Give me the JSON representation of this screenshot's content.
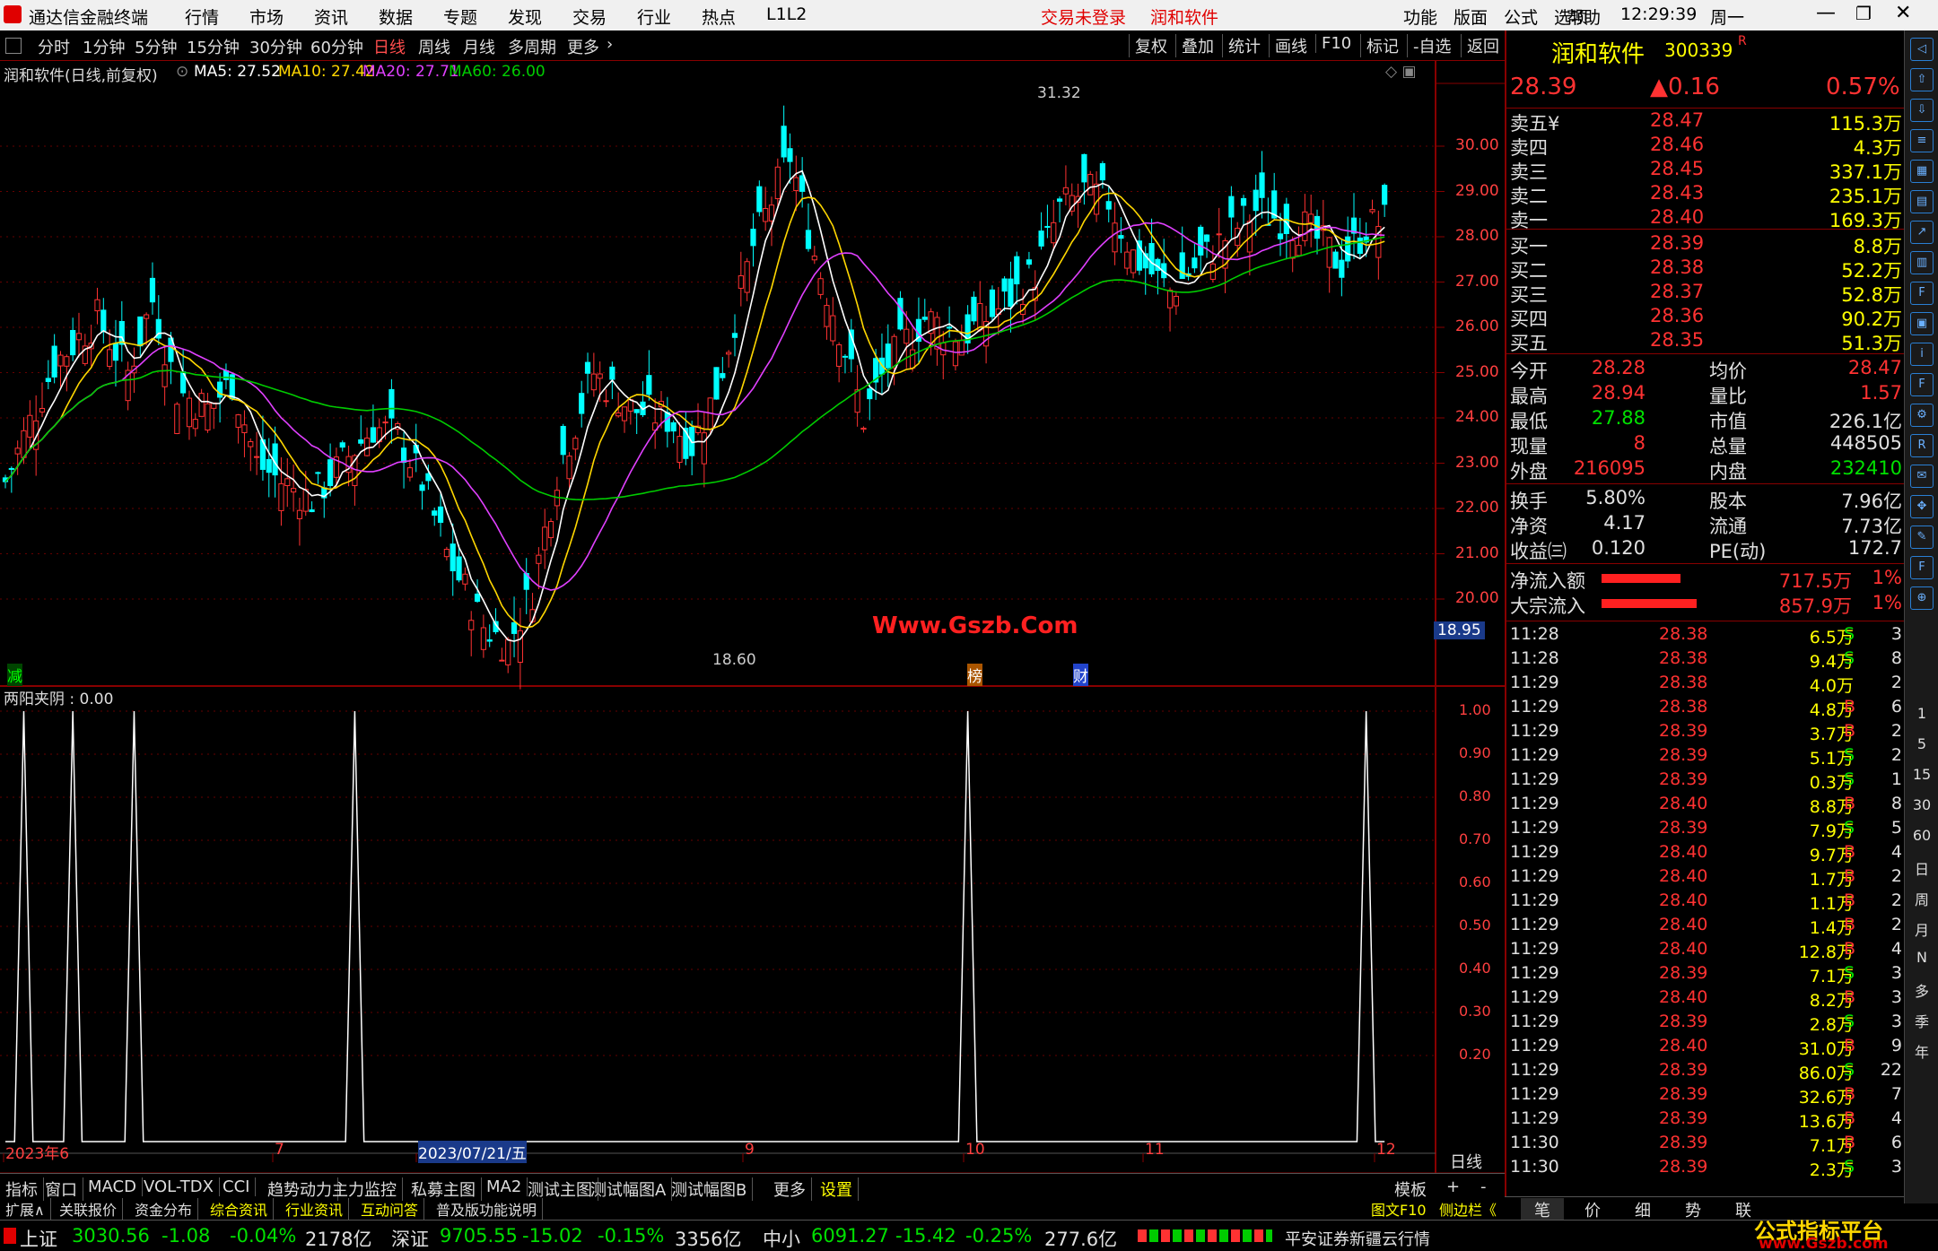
{
  "menu": {
    "app_title": "通达信金融终端",
    "items": [
      "行情",
      "市场",
      "资讯",
      "数据",
      "专题",
      "发现",
      "交易",
      "行业",
      "热点",
      "L1L2"
    ],
    "login": "交易未登录",
    "stock_name_top": "润和软件",
    "right_items": [
      "功能",
      "版面",
      "公式",
      "选项",
      "帮助"
    ],
    "clock": "12:29:39",
    "weekday": "周一"
  },
  "periods": [
    "分时",
    "1分钟",
    "5分钟",
    "15分钟",
    "30分钟",
    "60分钟",
    "日线",
    "周线",
    "月线",
    "多周期",
    "更多"
  ],
  "toolbar_right": [
    "复权",
    "叠加",
    "统计",
    "画线",
    "F10",
    "标记",
    "-自选",
    "返回"
  ],
  "legend": {
    "name": "润和软件(日线,前复权)",
    "ma5": "MA5: 27.52",
    "ma10": "MA10: 27.42",
    "ma20": "MA20: 27.71",
    "ma60": "MA60: 26.00"
  },
  "chart_labels": {
    "high": "31.32",
    "low": "18.60",
    "watermark": "Www.Gszb.Com",
    "cursor_price": "18.95",
    "mark_jian": "减",
    "mark_bang": "榜",
    "mark_cai": "财"
  },
  "indicator": {
    "title": "两阳夹阴 : 0.00"
  },
  "x_axis": {
    "labels": [
      "2023年6",
      "7",
      "2023/07/21/五",
      "9",
      "10",
      "11",
      "12"
    ],
    "right_label": "日线"
  },
  "chart_data": [
    {
      "type": "candlestick",
      "ylim": [
        18.6,
        31.32
      ],
      "price_axis": [
        "30.00",
        "29.00",
        "28.00",
        "27.00",
        "26.00",
        "25.00",
        "24.00",
        "23.00",
        "22.00",
        "21.00",
        "20.00"
      ],
      "high": 31.32,
      "low": 18.6,
      "series": [
        {
          "name": "MA5",
          "value": "27.52"
        },
        {
          "name": "MA10",
          "value": "27.42"
        },
        {
          "name": "MA20",
          "value": "27.71"
        },
        {
          "name": "MA60",
          "value": "26.00"
        }
      ]
    },
    {
      "type": "line",
      "name": "两阳夹阴",
      "ylim": [
        0,
        1
      ],
      "y_axis": [
        "1.00",
        "0.90",
        "0.80",
        "0.70",
        "0.60",
        "0.50",
        "0.40",
        "0.30",
        "0.20"
      ],
      "spikes": [
        3,
        11,
        21,
        57,
        157,
        222
      ]
    }
  ],
  "quote": {
    "name": "润和软件",
    "code": "300339",
    "badge": "R",
    "price": "28.39",
    "change": "▲0.16",
    "pct": "0.57%",
    "asks": [
      [
        "卖五¥",
        "28.47",
        "115.3万"
      ],
      [
        "卖四",
        "28.46",
        "4.3万"
      ],
      [
        "卖三",
        "28.45",
        "337.1万"
      ],
      [
        "卖二",
        "28.43",
        "235.1万"
      ],
      [
        "卖一",
        "28.40",
        "169.3万"
      ]
    ],
    "bids": [
      [
        "买一",
        "28.39",
        "8.8万"
      ],
      [
        "买二",
        "28.38",
        "52.2万"
      ],
      [
        "买三",
        "28.37",
        "52.8万"
      ],
      [
        "买四",
        "28.36",
        "90.2万"
      ],
      [
        "买五",
        "28.35",
        "51.3万"
      ]
    ],
    "stats": [
      [
        "今开",
        "28.28",
        "均价",
        "28.47"
      ],
      [
        "最高",
        "28.94",
        "量比",
        "1.57"
      ],
      [
        "最低",
        "27.88",
        "市值",
        "226.1亿"
      ],
      [
        "现量",
        "8",
        "总量",
        "448505"
      ],
      [
        "外盘",
        "216095",
        "内盘",
        "232410"
      ]
    ],
    "stats2": [
      [
        "换手",
        "5.80%",
        "股本",
        "7.96亿"
      ],
      [
        "净资",
        "4.17",
        "流通",
        "7.73亿"
      ],
      [
        "收益㈢",
        "0.120",
        "PE(动)",
        "172.7"
      ]
    ],
    "flow": [
      [
        "净流入额",
        "717.5万",
        "1%"
      ],
      [
        "大宗流入",
        "857.9万",
        "1%"
      ]
    ],
    "ticks": [
      [
        "11:28",
        "28.38",
        "6.5万",
        "S",
        "3"
      ],
      [
        "11:28",
        "28.38",
        "9.4万",
        "S",
        "8"
      ],
      [
        "11:29",
        "28.38",
        "4.0万",
        "",
        "2"
      ],
      [
        "11:29",
        "28.38",
        "4.8万",
        "B",
        "6"
      ],
      [
        "11:29",
        "28.39",
        "3.7万",
        "B",
        "2"
      ],
      [
        "11:29",
        "28.39",
        "5.1万",
        "S",
        "2"
      ],
      [
        "11:29",
        "28.39",
        "0.3万",
        "S",
        "1"
      ],
      [
        "11:29",
        "28.40",
        "8.8万",
        "B",
        "8"
      ],
      [
        "11:29",
        "28.39",
        "7.9万",
        "S",
        "5"
      ],
      [
        "11:29",
        "28.40",
        "9.7万",
        "B",
        "4"
      ],
      [
        "11:29",
        "28.40",
        "1.7万",
        "B",
        "2"
      ],
      [
        "11:29",
        "28.40",
        "1.1万",
        "B",
        "2"
      ],
      [
        "11:29",
        "28.40",
        "1.4万",
        "B",
        "2"
      ],
      [
        "11:29",
        "28.40",
        "12.8万",
        "B",
        "4"
      ],
      [
        "11:29",
        "28.39",
        "7.1万",
        "S",
        "3"
      ],
      [
        "11:29",
        "28.40",
        "8.2万",
        "B",
        "3"
      ],
      [
        "11:29",
        "28.39",
        "2.8万",
        "S",
        "3"
      ],
      [
        "11:29",
        "28.40",
        "31.0万",
        "B",
        "9"
      ],
      [
        "11:29",
        "28.39",
        "86.0万",
        "S",
        "22"
      ],
      [
        "11:29",
        "28.39",
        "32.6万",
        "B",
        "7"
      ],
      [
        "11:29",
        "28.39",
        "13.6万",
        "B",
        "4"
      ],
      [
        "11:30",
        "28.39",
        "7.1万",
        "B",
        "6"
      ],
      [
        "11:30",
        "28.39",
        "2.3万",
        "S",
        "3"
      ]
    ]
  },
  "bottom_tabs1": [
    "指标",
    "窗口",
    "MACD",
    "VOL-TDX",
    "CCI",
    "趋势动力",
    "主力监控",
    "私募主图",
    "MA2",
    "测试主图",
    "测试幅图A",
    "测试幅图B",
    "更多",
    "设置"
  ],
  "bottom_tabs1_right": [
    "模板",
    "+",
    "-"
  ],
  "bottom_tabs2": [
    "扩展∧",
    "关联报价",
    "资金分布",
    "综合资讯",
    "行业资讯",
    "互动问答",
    "普及版功能说明"
  ],
  "bottom_tabs2_right": [
    "图文F10",
    "侧边栏《"
  ],
  "quote_tabs": [
    "笔",
    "价",
    "细",
    "势",
    "联"
  ],
  "status": {
    "sh_label": "上证",
    "sh": "3030.56",
    "sh_chg": "-1.08",
    "sh_pct": "-0.04%",
    "sh_amt": "2178亿",
    "sz_label": "深证",
    "sz": "9705.55",
    "sz_chg": "-15.02",
    "sz_pct": "-0.15%",
    "sz_amt": "3356亿",
    "zx_label": "中小",
    "zx": "6091.27",
    "zx_chg": "-15.42",
    "zx_pct": "-0.25%",
    "zx_amt": "277.6亿",
    "broker": "平安证券新疆云行情",
    "logo": "公式指标平台",
    "logo_url": "www.Gszb.com"
  },
  "side_labels": [
    "1",
    "5",
    "15",
    "30",
    "60",
    "日",
    "周",
    "月",
    "N",
    "多",
    "季",
    "年"
  ],
  "colors": {
    "up": "#ff3232",
    "down": "#00ffff",
    "ma5": "#ffffff",
    "ma10": "#ffd700",
    "ma20": "#e040ff",
    "ma60": "#00cc00"
  }
}
